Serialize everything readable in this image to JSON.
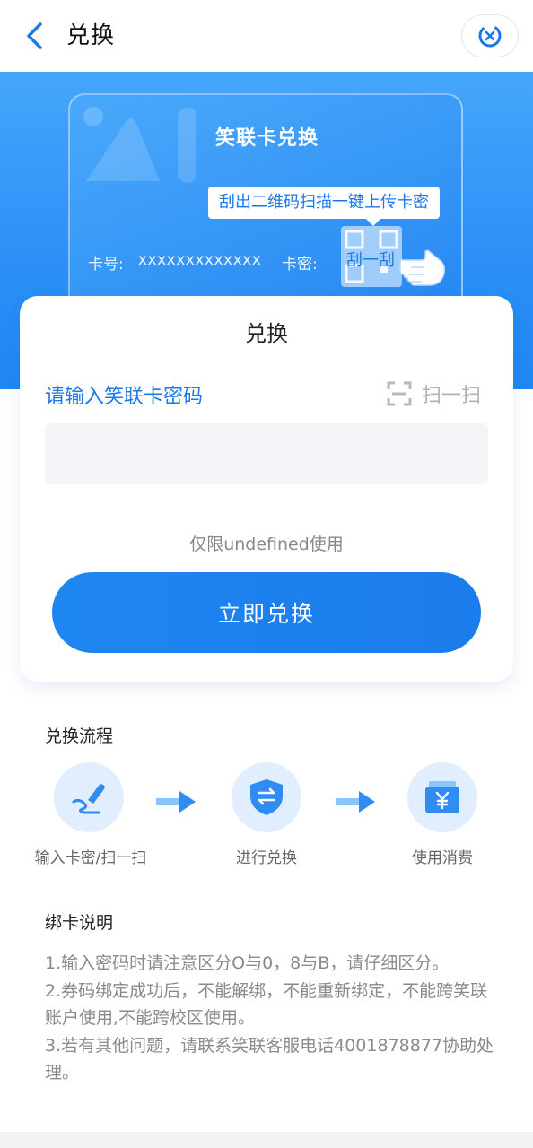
{
  "header": {
    "title": "兑换"
  },
  "card": {
    "title": "笑联卡兑换",
    "tip": "刮出二维码扫描一键上传卡密",
    "card_no_label": "卡号:",
    "card_no_value": "xxxxxxxxxxxxx",
    "card_pwd_label": "卡密:",
    "scratch_text": "刮一刮"
  },
  "main": {
    "title": "兑换",
    "input_label": "请输入笑联卡密码",
    "scan_label": "扫一扫",
    "input_value": "",
    "input_placeholder": "",
    "limit_text": "仅限undefined使用",
    "redeem_button": "立即兑换"
  },
  "flow": {
    "title": "兑换流程",
    "steps": [
      {
        "label": "输入卡密/扫一扫",
        "icon": "pen-icon"
      },
      {
        "label": "进行兑换",
        "icon": "shield-exchange-icon"
      },
      {
        "label": "使用消费",
        "icon": "yuan-wallet-icon"
      }
    ]
  },
  "notes": {
    "title": "绑卡说明",
    "lines": [
      "1.输入密码时请注意区分O与0，8与B，请仔细区分。",
      "2.券码绑定成功后，不能解绑，不能重新绑定，不能跨笑联账户使用,不能跨校区使用。",
      "3.若有其他问题，请联系笑联客服电话4001878877协助处理。"
    ]
  },
  "colors": {
    "accent": "#1e86f1",
    "banner": "#2b8ff6",
    "step_bg": "#e1eefd"
  }
}
